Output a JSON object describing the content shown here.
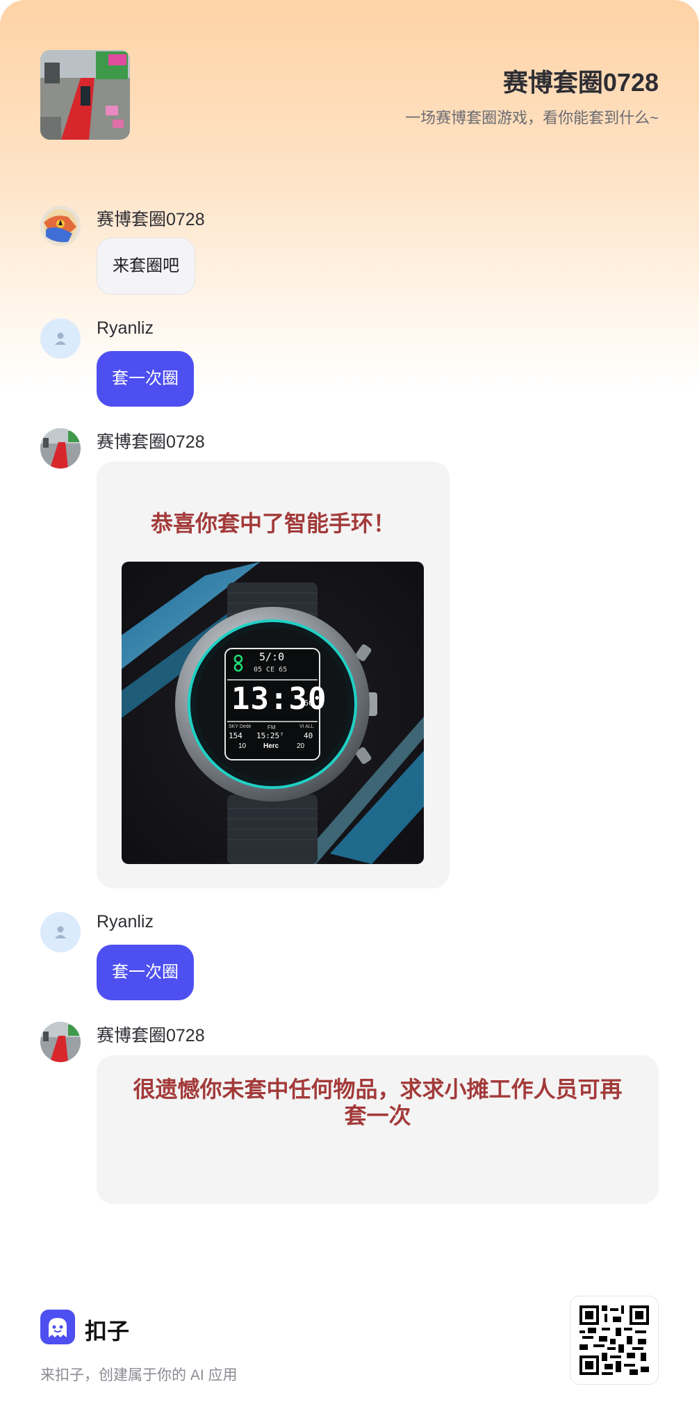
{
  "header": {
    "title": "赛博套圈0728",
    "subtitle": "一场赛博套圈游戏，看你能套到什么~"
  },
  "messages": [
    {
      "sender": "赛博套圈0728",
      "text": "来套圈吧"
    },
    {
      "sender": "Ryanliz",
      "text": "套一次圈"
    },
    {
      "sender": "赛博套圈0728",
      "text": "恭喜你套中了智能手环！"
    },
    {
      "sender": "Ryanliz",
      "text": "套一次圈"
    },
    {
      "sender": "赛博套圈0728",
      "text": "很遗憾你未套中任何物品，求求小摊工作人员可再套一次"
    }
  ],
  "watch_face": {
    "top": "5/:0",
    "date": "05 CE 65",
    "time": "13:30",
    "seconds": "60",
    "left_label": "SKY Dede",
    "left_value": "154",
    "center_label": "FM",
    "center_value": "15:25⁷",
    "right_label": "VI ALL",
    "right_value": "40",
    "bottom_left": "10",
    "bottom_center": "Herc",
    "bottom_right": "20"
  },
  "footer": {
    "brand": "扣子",
    "tagline": "来扣子，创建属于你的 AI 应用"
  },
  "colors": {
    "accent": "#4e4ff0",
    "card_title": "#a33a3a",
    "header_gradient_top": "#fed3a6"
  }
}
